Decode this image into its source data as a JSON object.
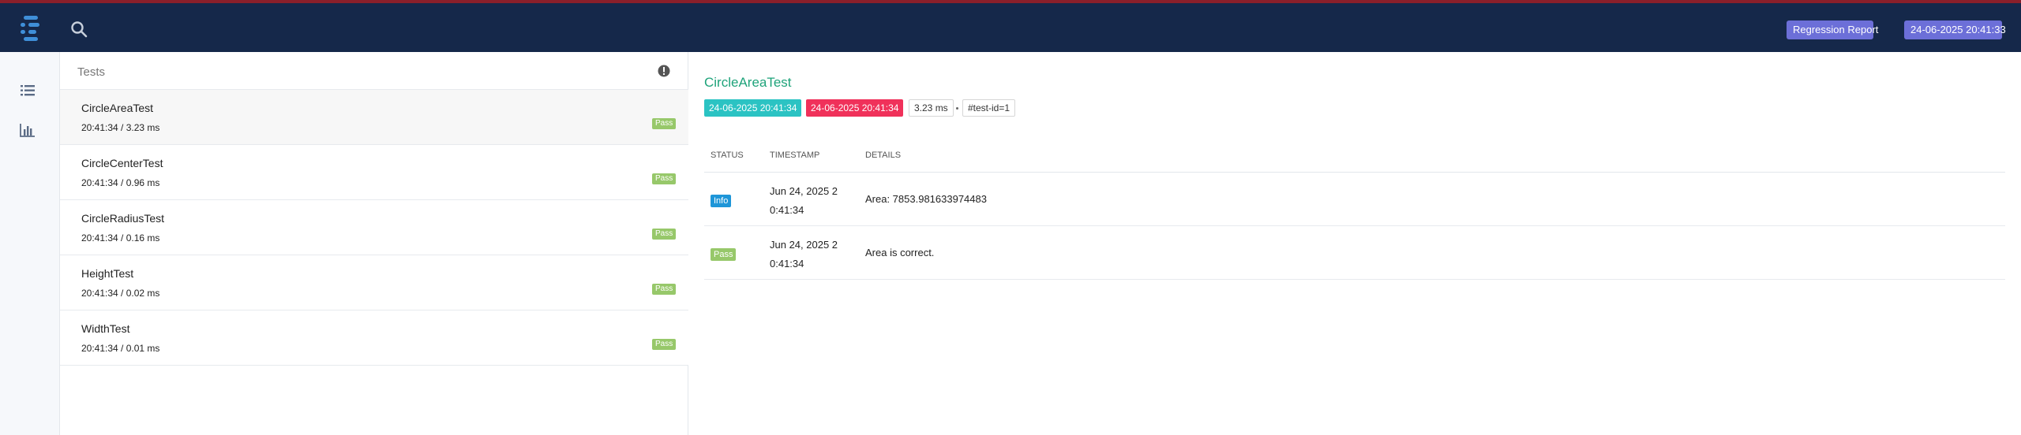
{
  "navbar": {
    "report_label": "Regression Report",
    "date_label": "24-06-2025 20:41:33",
    "colors": {
      "background": "#15284a",
      "badge": "#6c6fd8"
    }
  },
  "sidebar": {
    "icons": [
      "list-icon",
      "bar-chart-icon"
    ]
  },
  "test_list": {
    "header": "Tests",
    "items": [
      {
        "name": "CircleAreaTest",
        "meta": "20:41:34 / 3.23 ms",
        "status": "Pass"
      },
      {
        "name": "CircleCenterTest",
        "meta": "20:41:34 / 0.96 ms",
        "status": "Pass"
      },
      {
        "name": "CircleRadiusTest",
        "meta": "20:41:34 / 0.16 ms",
        "status": "Pass"
      },
      {
        "name": "HeightTest",
        "meta": "20:41:34 / 0.02 ms",
        "status": "Pass"
      },
      {
        "name": "WidthTest",
        "meta": "20:41:34 / 0.01 ms",
        "status": "Pass"
      }
    ]
  },
  "detail": {
    "title": "CircleAreaTest",
    "start_time": "24-06-2025 20:41:34",
    "end_time": "24-06-2025 20:41:34",
    "duration": "3.23 ms",
    "test_id": "#test-id=1",
    "log_headers": {
      "status": "STATUS",
      "timestamp": "TIMESTAMP",
      "details": "DETAILS"
    },
    "logs": [
      {
        "status": "Info",
        "timestamp": "Jun 24, 2025 2 0:41:34",
        "details": "Area: 7853.981633974483"
      },
      {
        "status": "Pass",
        "timestamp": "Jun 24, 2025 2 0:41:34",
        "details": "Area is correct."
      }
    ],
    "colors": {
      "title": "#1ea37a",
      "start": "#2bc3c3",
      "end": "#f0315a",
      "info": "#1e96d8",
      "pass": "#97c86a"
    }
  }
}
